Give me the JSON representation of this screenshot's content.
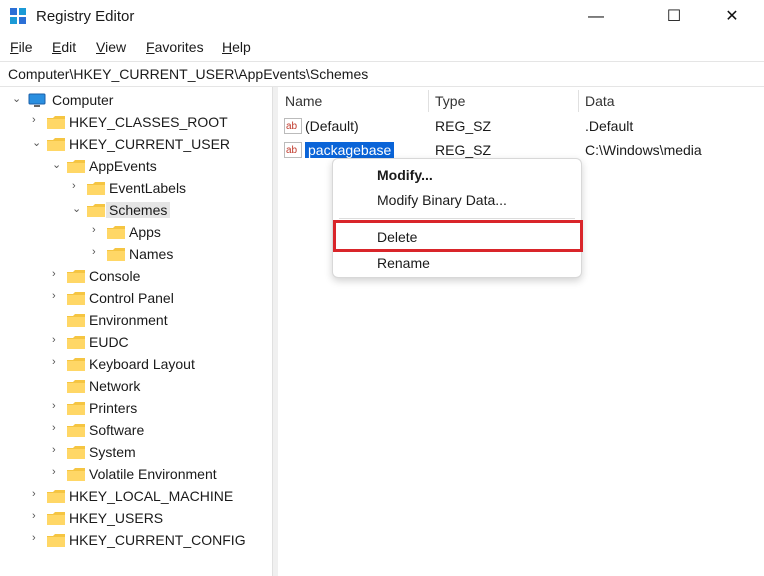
{
  "window": {
    "title": "Registry Editor",
    "icon": "registry-icon",
    "controls": {
      "minimize": "—",
      "maximize": "☐",
      "close": "✕"
    }
  },
  "menu": {
    "items": [
      {
        "ul": "F",
        "rest": "ile"
      },
      {
        "ul": "E",
        "rest": "dit"
      },
      {
        "ul": "V",
        "rest": "iew"
      },
      {
        "ul": "F",
        "rest": "avorites",
        "pre": "",
        "full": "Favorites"
      },
      {
        "ul": "H",
        "rest": "elp"
      }
    ]
  },
  "address": {
    "path": "Computer\\HKEY_CURRENT_USER\\AppEvents\\Schemes"
  },
  "tree": {
    "computer": "Computer",
    "nodes": [
      "HKEY_CLASSES_ROOT",
      "HKEY_CURRENT_USER",
      "AppEvents",
      "EventLabels",
      "Schemes",
      "Apps",
      "Names",
      "Console",
      "Control Panel",
      "Environment",
      "EUDC",
      "Keyboard Layout",
      "Network",
      "Printers",
      "Software",
      "System",
      "Volatile Environment",
      "HKEY_LOCAL_MACHINE",
      "HKEY_USERS",
      "HKEY_CURRENT_CONFIG"
    ]
  },
  "list": {
    "headers": {
      "name": "Name",
      "type": "Type",
      "data": "Data"
    },
    "rows": [
      {
        "name": "(Default)",
        "type": "REG_SZ",
        "data": ".Default"
      },
      {
        "name": "packagebase",
        "type": "REG_SZ",
        "data": "C:\\Windows\\media"
      }
    ]
  },
  "context_menu": {
    "modify": "Modify...",
    "modify_binary": "Modify Binary Data...",
    "delete": "Delete",
    "rename": "Rename"
  },
  "colors": {
    "selection": "#0a64d8",
    "highlight_box": "#d9252a",
    "folder": "#f5c542"
  }
}
